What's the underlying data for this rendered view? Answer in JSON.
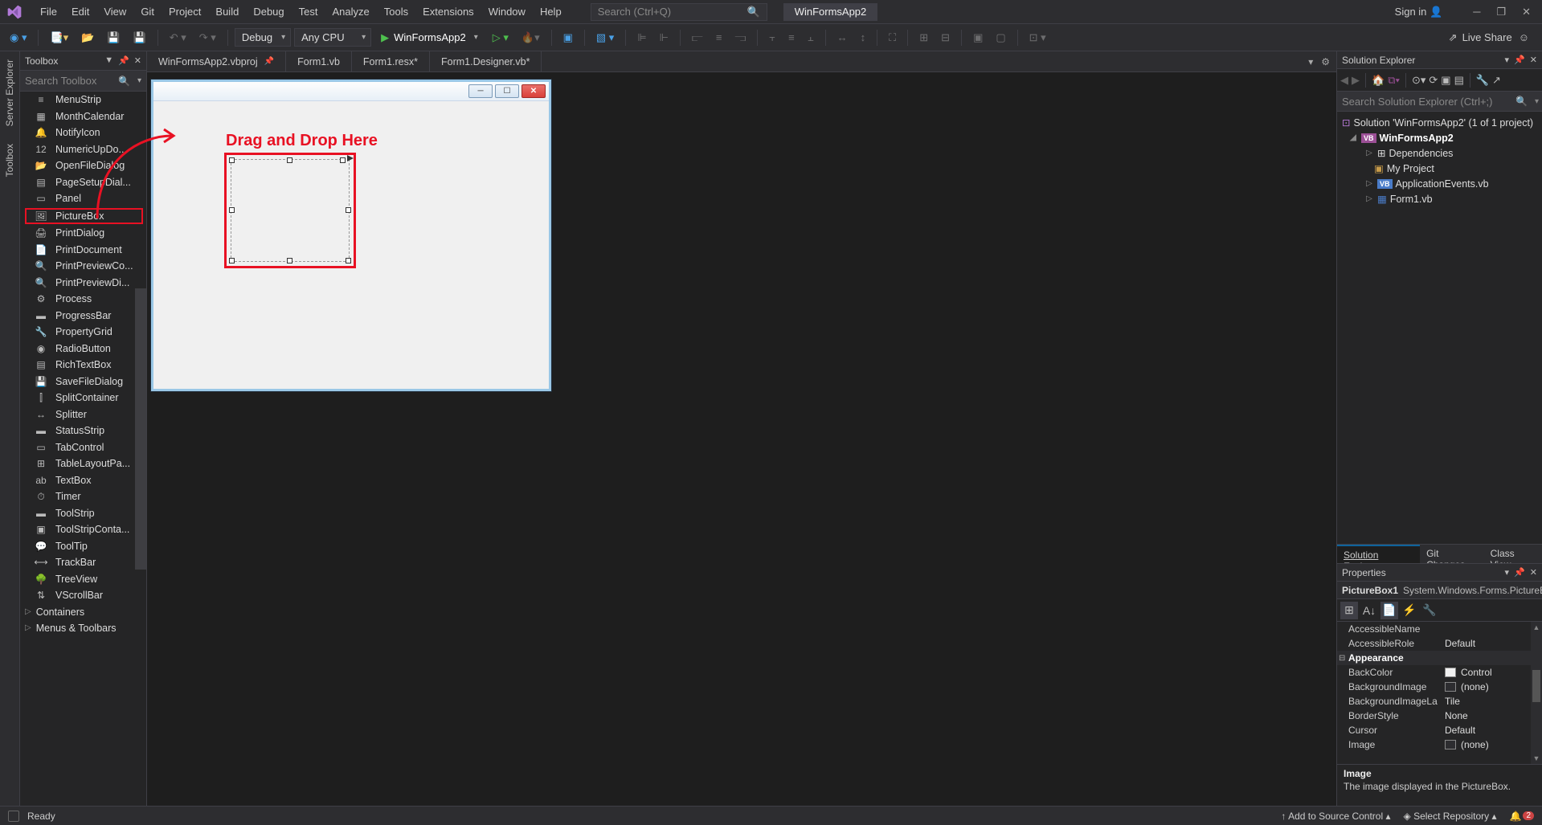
{
  "menu": {
    "items": [
      "File",
      "Edit",
      "View",
      "Git",
      "Project",
      "Build",
      "Debug",
      "Test",
      "Analyze",
      "Tools",
      "Extensions",
      "Window",
      "Help"
    ],
    "search_placeholder": "Search (Ctrl+Q)",
    "project": "WinFormsApp2",
    "sign_in": "Sign in"
  },
  "toolbar": {
    "config": "Debug",
    "platform": "Any CPU",
    "start": "WinFormsApp2",
    "liveshare": "Live Share"
  },
  "rail": {
    "tabs": [
      "Server Explorer",
      "Toolbox"
    ]
  },
  "toolbox": {
    "title": "Toolbox",
    "search_placeholder": "Search Toolbox",
    "items": [
      "MenuStrip",
      "MonthCalendar",
      "NotifyIcon",
      "NumericUpDo...",
      "OpenFileDialog",
      "PageSetupDial...",
      "Panel",
      "PictureBox",
      "PrintDialog",
      "PrintDocument",
      "PrintPreviewCo...",
      "PrintPreviewDi...",
      "Process",
      "ProgressBar",
      "PropertyGrid",
      "RadioButton",
      "RichTextBox",
      "SaveFileDialog",
      "SplitContainer",
      "Splitter",
      "StatusStrip",
      "TabControl",
      "TableLayoutPa...",
      "TextBox",
      "Timer",
      "ToolStrip",
      "ToolStripConta...",
      "ToolTip",
      "TrackBar",
      "TreeView",
      "VScrollBar"
    ],
    "selected_index": 7,
    "groups": [
      "Containers",
      "Menus & Toolbars"
    ]
  },
  "tabs": {
    "items": [
      "WinFormsApp2.vbproj",
      "Form1.vb",
      "Form1.resx*",
      "Form1.Designer.vb*"
    ]
  },
  "annotation": {
    "text": "Drag and Drop Here"
  },
  "solution": {
    "title": "Solution Explorer",
    "search_placeholder": "Search Solution Explorer (Ctrl+;)",
    "root": "Solution 'WinFormsApp2' (1 of 1 project)",
    "project": "WinFormsApp2",
    "nodes": [
      "Dependencies",
      "My Project",
      "ApplicationEvents.vb",
      "Form1.vb"
    ],
    "bottom_tabs": [
      "Solution Explorer",
      "Git Changes",
      "Class View"
    ]
  },
  "properties": {
    "title": "Properties",
    "object_name": "PictureBox1",
    "object_type": "System.Windows.Forms.PictureB",
    "rows": [
      {
        "k": "AccessibleName",
        "v": ""
      },
      {
        "k": "AccessibleRole",
        "v": "Default"
      }
    ],
    "category": "Appearance",
    "rows2": [
      {
        "k": "BackColor",
        "v": "Control",
        "swatch": true
      },
      {
        "k": "BackgroundImage",
        "v": "(none)",
        "swatch_empty": true
      },
      {
        "k": "BackgroundImageLa",
        "v": "Tile"
      },
      {
        "k": "BorderStyle",
        "v": "None"
      },
      {
        "k": "Cursor",
        "v": "Default"
      },
      {
        "k": "Image",
        "v": "(none)",
        "swatch_empty": true
      }
    ],
    "desc_title": "Image",
    "desc_text": "The image displayed in the PictureBox."
  },
  "status": {
    "ready": "Ready",
    "add_src": "Add to Source Control",
    "select_repo": "Select Repository",
    "notif_count": "2"
  }
}
